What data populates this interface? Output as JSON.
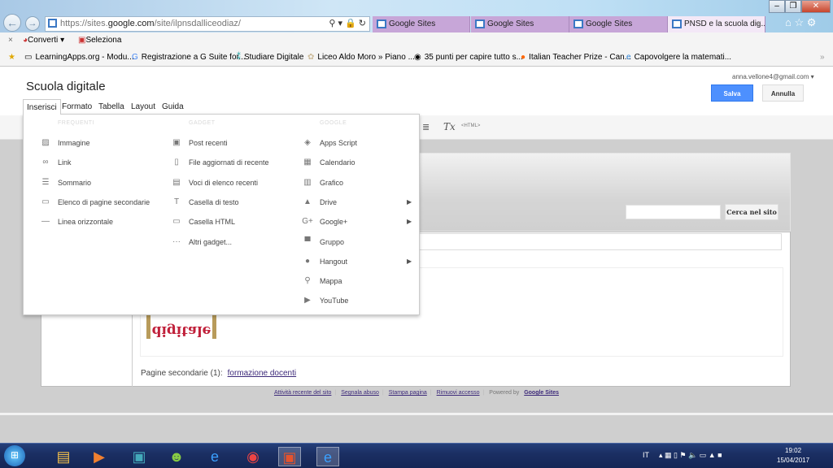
{
  "browser": {
    "url_host_prefix": "https://sites.",
    "url_host": "google.com",
    "url_path": "/site/ilpnsdalliceodiaz/",
    "tabs": [
      {
        "label": "Google Sites"
      },
      {
        "label": "Google Sites"
      },
      {
        "label": "Google Sites"
      },
      {
        "label": "PNSD e la scuola dig...",
        "active": true
      }
    ],
    "command_bar": {
      "convert": "Converti",
      "select": "Seleziona"
    },
    "favorites": [
      "LearningApps.org - Modu...",
      "Registrazione a G Suite for...",
      "Studiare Digitale",
      "Liceo Aldo Moro » Piano ...",
      "35 punti per capire tutto s...",
      "Italian Teacher Prize - Can...",
      "Capovolgere la matemati..."
    ]
  },
  "editor": {
    "site_title": "Scuola digitale",
    "account": "anna.vellone4@gmail.com",
    "save": "Salva",
    "cancel": "Annulla",
    "menus": [
      "Inserisci",
      "Formato",
      "Tabella",
      "Layout",
      "Guida"
    ],
    "toolbar_html": "<HTML>",
    "accent_color": "#4d90fe"
  },
  "insert_menu": {
    "columns": [
      {
        "heading": "FREQUENTI",
        "items": [
          {
            "label": "Immagine",
            "icon": "image-icon"
          },
          {
            "label": "Link",
            "icon": "link-icon"
          },
          {
            "label": "Sommario",
            "icon": "list-icon"
          },
          {
            "label": "Elenco di pagine secondarie",
            "icon": "subpages-icon"
          },
          {
            "label": "Linea orizzontale",
            "icon": "horizontal-line-icon"
          }
        ]
      },
      {
        "heading": "GADGET",
        "items": [
          {
            "label": "Post recenti",
            "icon": "posts-icon"
          },
          {
            "label": "File aggiornati di recente",
            "icon": "file-icon"
          },
          {
            "label": "Voci di elenco recenti",
            "icon": "list-items-icon"
          },
          {
            "label": "Casella di testo",
            "icon": "text-box-icon"
          },
          {
            "label": "Casella HTML",
            "icon": "html-box-icon"
          },
          {
            "label": "Altri gadget...",
            "icon": "more-icon"
          }
        ]
      },
      {
        "heading": "GOOGLE",
        "items": [
          {
            "label": "Apps Script",
            "icon": "apps-script-icon"
          },
          {
            "label": "Calendario",
            "icon": "calendar-icon"
          },
          {
            "label": "Grafico",
            "icon": "chart-icon"
          },
          {
            "label": "Drive",
            "icon": "drive-icon",
            "submenu": true
          },
          {
            "label": "Google+",
            "icon": "google-plus-icon",
            "submenu": true
          },
          {
            "label": "Gruppo",
            "icon": "group-icon"
          },
          {
            "label": "Hangout",
            "icon": "hangout-icon",
            "submenu": true
          },
          {
            "label": "Mappa",
            "icon": "map-pin-icon"
          },
          {
            "label": "YouTube",
            "icon": "youtube-icon"
          }
        ]
      }
    ]
  },
  "site": {
    "search_button": "Cerca nel sito",
    "logo_text": "digitale",
    "subpages_label": "Pagine secondarie (1):",
    "subpages_link": "formazione docenti",
    "footer": {
      "links": [
        "Attività recente del sito",
        "Segnala abuso",
        "Stampa pagina",
        "Rimuovi accesso"
      ],
      "powered": "Powered by",
      "brand": "Google Sites"
    }
  },
  "taskbar": {
    "language": "IT",
    "time": "19:02",
    "date": "15/04/2017"
  }
}
